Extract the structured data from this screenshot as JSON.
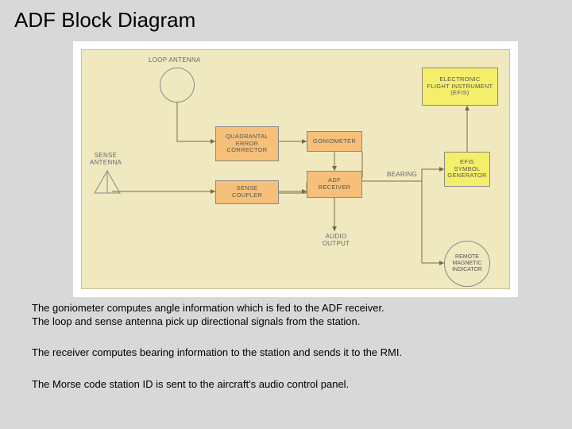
{
  "title": "ADF Block Diagram",
  "labels": {
    "loop": "LOOP ANTENNA",
    "sense": "SENSE\nANTENNA",
    "bearing": "BEARING",
    "audio": "AUDIO\nOUTPUT"
  },
  "blocks": {
    "qec": "QUADRANTAL\nERROR\nCORRECTOR",
    "gon": "GONIOMETER",
    "coupler": "SENSE\nCOUPLER",
    "adf": "ADF\nRECEIVER",
    "efi": "ELECTRONIC\nFLIGHT INSTRUMENT\n(EFIS)",
    "symgen": "EFIS\nSYMBOL\nGENERATOR",
    "rmi": "REMOTE\nMAGNETIC\nINDICATOR"
  },
  "captions": {
    "c1a": "The goniometer computes angle information which is fed to the ADF receiver.",
    "c1b": "The loop  and sense antenna pick up directional signals from the station.",
    "c2": "The receiver computes bearing information to the station and sends it to the RMI.",
    "c3": "The Morse code station ID is sent to the aircraft's audio control panel."
  }
}
